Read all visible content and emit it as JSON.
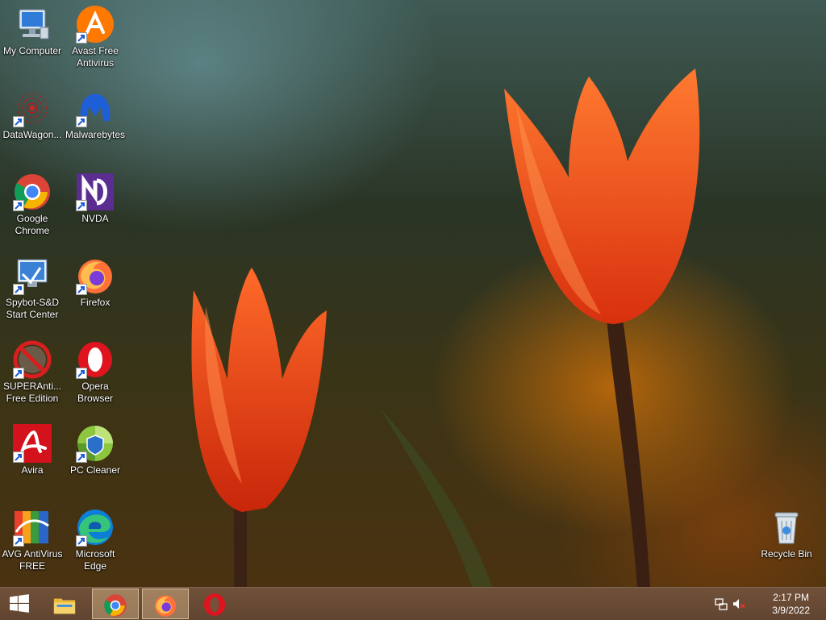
{
  "desktop": {
    "icons": [
      {
        "label": "My Computer",
        "icon": "computer-icon"
      },
      {
        "label": "Avast Free Antivirus",
        "icon": "avast-icon"
      },
      {
        "label": "DataWagon...",
        "icon": "datawagon-icon"
      },
      {
        "label": "Malwarebytes",
        "icon": "malwarebytes-icon"
      },
      {
        "label": "Google Chrome",
        "icon": "chrome-icon"
      },
      {
        "label": "NVDA",
        "icon": "nvda-icon"
      },
      {
        "label": "Spybot-S&D Start Center",
        "icon": "spybot-icon"
      },
      {
        "label": "Firefox",
        "icon": "firefox-icon"
      },
      {
        "label": "SUPERAnti... Free Edition",
        "icon": "superantispyware-icon"
      },
      {
        "label": "Opera Browser",
        "icon": "opera-icon"
      },
      {
        "label": "Avira",
        "icon": "avira-icon"
      },
      {
        "label": "PC Cleaner",
        "icon": "pc-cleaner-icon"
      },
      {
        "label": "AVG AntiVirus FREE",
        "icon": "avg-icon"
      },
      {
        "label": "Microsoft Edge",
        "icon": "edge-icon"
      },
      {
        "label": "Recycle Bin",
        "icon": "recycle-bin-icon"
      }
    ]
  },
  "taskbar": {
    "start": {
      "icon": "windows-logo-icon"
    },
    "pinned": [
      {
        "name": "File Explorer",
        "icon": "file-explorer-icon",
        "active": false
      },
      {
        "name": "Google Chrome",
        "icon": "chrome-icon",
        "active": true
      },
      {
        "name": "Firefox",
        "icon": "firefox-icon",
        "active": true
      },
      {
        "name": "Opera",
        "icon": "opera-icon",
        "active": false
      }
    ],
    "tray": {
      "network_icon": "network-icon",
      "volume_icon": "volume-muted-icon",
      "time": "2:17 PM",
      "date": "3/9/2022"
    }
  },
  "colors": {
    "taskbar": "#72523a",
    "label_text": "#ffffff"
  }
}
